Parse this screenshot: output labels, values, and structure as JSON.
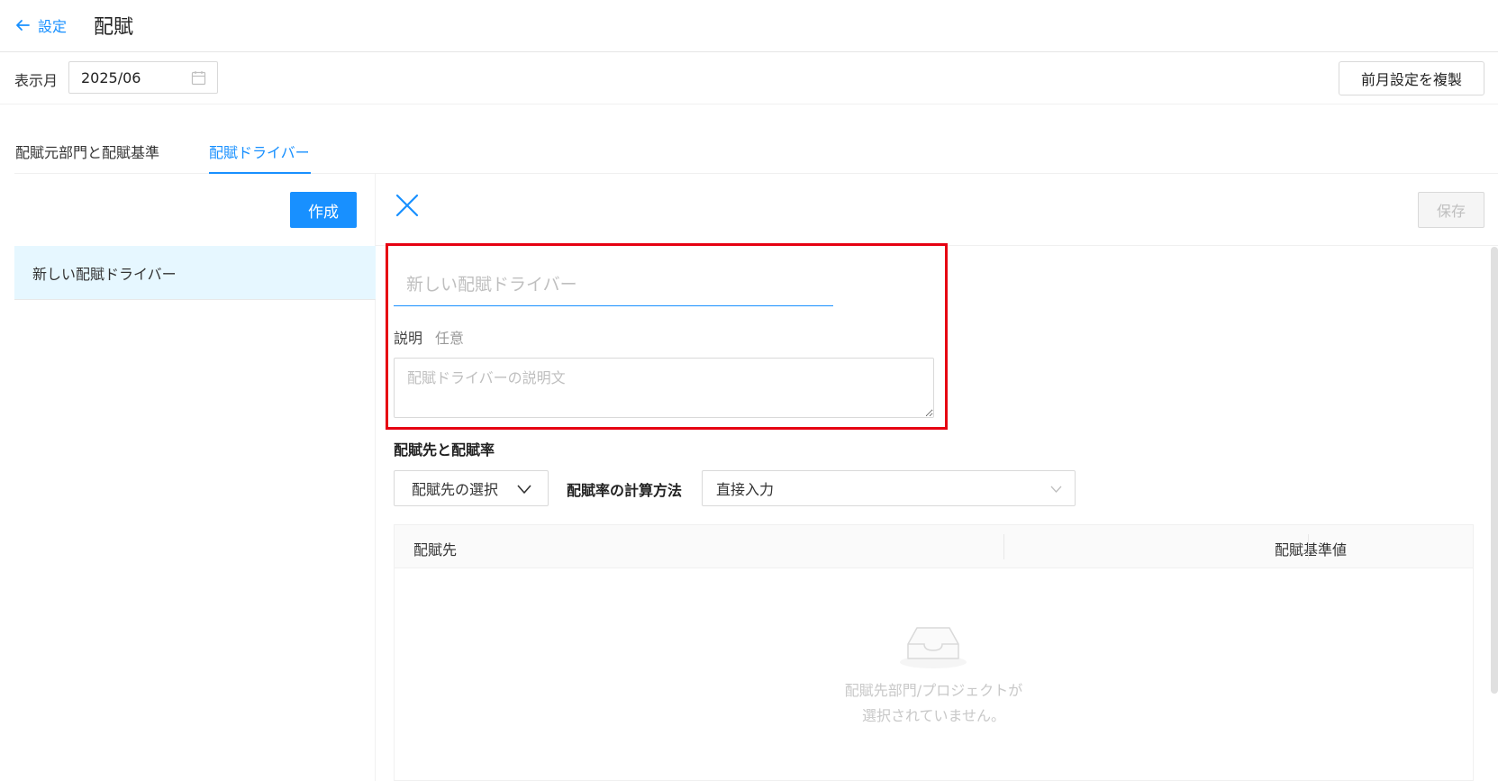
{
  "header": {
    "back_label": "設定",
    "title": "配賦"
  },
  "month_bar": {
    "label": "表示月",
    "value": "2025/06",
    "copy_button": "前月設定を複製"
  },
  "tabs": [
    {
      "label": "配賦元部門と配賦基準",
      "active": false
    },
    {
      "label": "配賦ドライバー",
      "active": true
    }
  ],
  "left_panel": {
    "create_button": "作成",
    "items": [
      {
        "label": "新しい配賦ドライバー",
        "selected": true
      }
    ]
  },
  "editor": {
    "save_button": "保存",
    "name_placeholder": "新しい配賦ドライバー",
    "desc_label": "説明",
    "desc_optional": "任意",
    "desc_placeholder": "配賦ドライバーの説明文",
    "section_title": "配賦先と配賦率",
    "select_dest_label": "配賦先の選択",
    "calc_method_label": "配賦率の計算方法",
    "calc_method_value": "直接入力",
    "table": {
      "col_dest": "配賦先",
      "col_base": "配賦基準値",
      "empty_line1": "配賦先部門/プロジェクトが",
      "empty_line2": "選択されていません。"
    }
  },
  "colors": {
    "primary": "#1890ff",
    "highlight_border": "#e60012",
    "selected_bg": "#e6f7ff"
  }
}
